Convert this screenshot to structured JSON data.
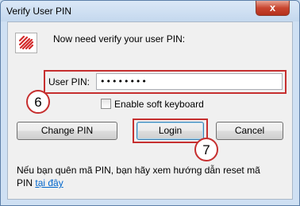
{
  "window": {
    "title": "Verify User PIN",
    "close_label": "x"
  },
  "message": "Now need verify your user PIN:",
  "pin": {
    "label": "User PIN:",
    "value": "••••••••"
  },
  "soft_keyboard": {
    "label": "Enable soft keyboard",
    "checked": false
  },
  "buttons": {
    "change_pin": "Change PIN",
    "login": "Login",
    "cancel": "Cancel"
  },
  "callouts": {
    "pin_step": "6",
    "login_step": "7"
  },
  "help": {
    "text": "Nếu bạn quên mã PIN, bạn hãy xem hướng dẫn reset mã PIN",
    "link": "tại đây"
  },
  "colors": {
    "highlight": "#c62f2f",
    "logo_red": "#d32a2a",
    "link": "#0066cc"
  }
}
